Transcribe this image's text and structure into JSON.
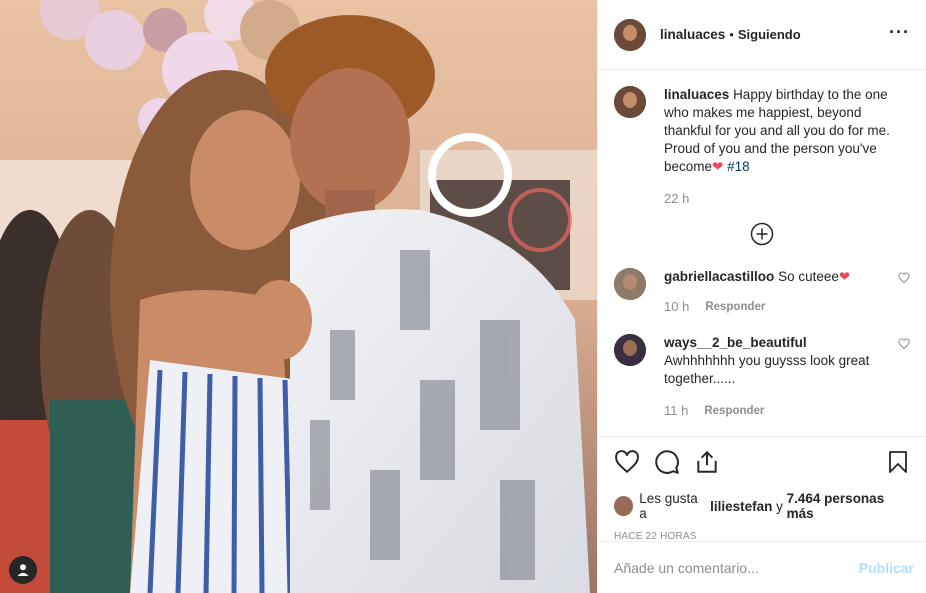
{
  "post": {
    "author": "linaluaces",
    "separator": "•",
    "follow_status": "Siguiendo",
    "more_icon": "more-options-icon"
  },
  "caption": {
    "username": "linaluaces",
    "text": "Happy birthday to the one who makes me happiest, beyond thankful for you and all you do for me. Proud of you and the person you've become",
    "emoji": "❤",
    "hashtag": "#18",
    "time": "22 h"
  },
  "comments": [
    {
      "username": "gabriellacastilloo",
      "text": "So cuteee",
      "emoji": "❤",
      "time": "10 h",
      "reply": "Responder"
    },
    {
      "username": "ways__2_be_beautiful",
      "text": "Awhhhhhhh you guysss look great together......",
      "time": "11 h",
      "reply": "Responder"
    }
  ],
  "likes": {
    "prefix": "Les gusta a",
    "user": "liliestefan",
    "connector": "y",
    "others": "7.464 personas más"
  },
  "timestamp": "HACE 22 HORAS",
  "add_comment": {
    "placeholder": "Añade un comentario...",
    "post_label": "Publicar"
  },
  "colors": {
    "accent": "#0095f6",
    "post_disabled": "#b2dffc",
    "heart": "#ed4956",
    "hashtag": "#00376b",
    "muted": "#8e8e8e"
  }
}
